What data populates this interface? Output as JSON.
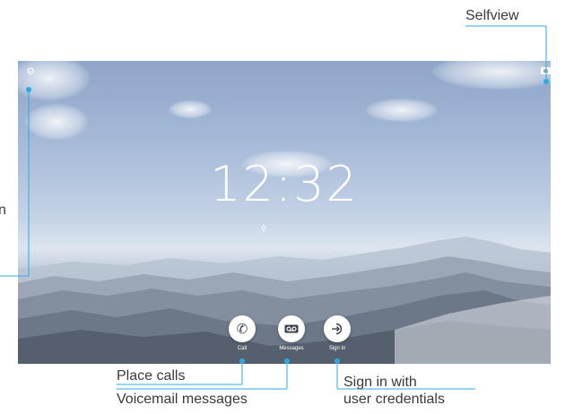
{
  "screen": {
    "time": "12:32",
    "icons": {
      "settings": "gear-icon",
      "selfview": "selfview-icon",
      "location": "location-pin-icon"
    },
    "actions": [
      {
        "label": "Call",
        "icon": "phone-icon"
      },
      {
        "label": "Messages",
        "icon": "voicemail-icon"
      },
      {
        "label": "Sign in",
        "icon": "sign-in-icon"
      }
    ]
  },
  "callouts": {
    "selfview": "Selfview",
    "settings_partial": "n",
    "place_calls": "Place calls",
    "voicemail": "Voicemail messages",
    "sign_in_line1": "Sign in with",
    "sign_in_line2": "user credentials"
  },
  "colors": {
    "callout_line": "#29abe2",
    "callout_text": "#3a3a3a",
    "icon_white": "#ffffff"
  }
}
